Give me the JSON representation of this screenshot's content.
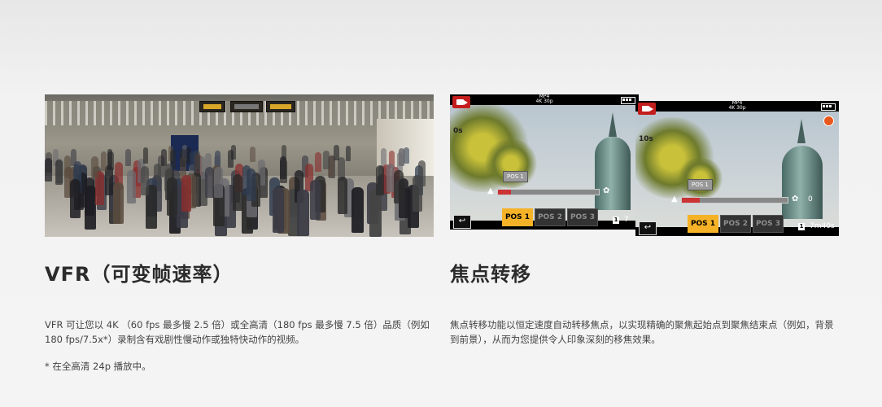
{
  "left": {
    "title": "VFR（可变帧速率）",
    "description": "VFR 可让您以 4K （60 fps 最多慢 2.5 倍）或全高清（180 fps 最多慢 7.5 倍）品质（例如 180 fps/7.5x*）录制含有戏剧性慢动作或独特快动作的视频。",
    "note": "* 在全高清 24p 播放中。"
  },
  "right": {
    "title": "焦点转移",
    "description": "焦点转移功能以恒定速度自动转移焦点，以实现精确的聚焦起始点到聚焦结束点（例如，背景到前景），从而为您提供令人印象深刻的移焦效果。"
  },
  "screen_back": {
    "format": "MP4",
    "quality": "4K 30p",
    "time": "0s",
    "pos_tag": "POS 1",
    "buttons": [
      "POS 1",
      "POS 2",
      "POS 3"
    ],
    "count": "7"
  },
  "screen_front": {
    "format": "MP4",
    "quality": "4K 30p",
    "time": "10s",
    "pos_tag": "POS 1",
    "buttons": [
      "POS 1",
      "POS 2",
      "POS 3"
    ],
    "zero": "0",
    "count": "7m40s"
  },
  "colors": {
    "active_button": "#f5b227",
    "rec_red": "#c41d1d",
    "rec_dot": "#e8571b"
  }
}
